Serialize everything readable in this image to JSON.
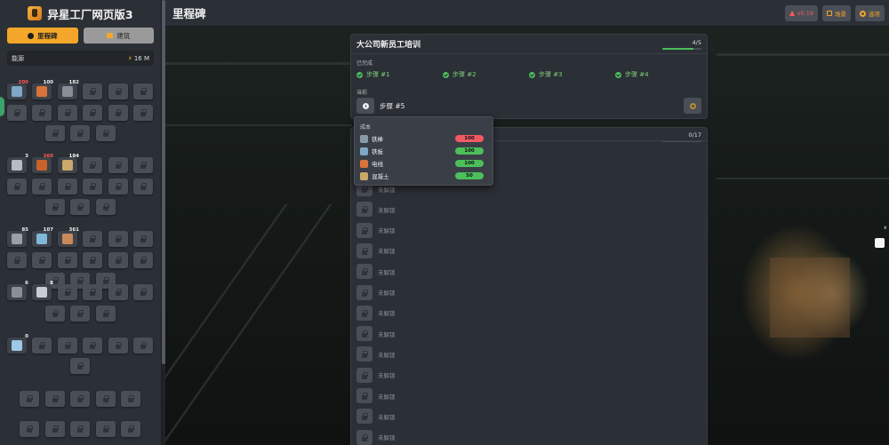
{
  "brand": {
    "title": "异星工厂网页版3"
  },
  "sidebar": {
    "tabs": [
      {
        "label": "里程碑",
        "active": true
      },
      {
        "label": "建筑",
        "active": false
      }
    ],
    "energy": {
      "label": "能源",
      "value": "16 M"
    },
    "item_counts": [
      "200",
      "100",
      "182",
      "3",
      "360",
      "184",
      "85",
      "107",
      "361",
      "6",
      "8",
      "0"
    ]
  },
  "header": {
    "title": "里程碑",
    "buttons": [
      {
        "label": "v0.19",
        "color": "#ff5a5a"
      },
      {
        "label": "场景",
        "color": "#f4a62a"
      },
      {
        "label": "选项",
        "color": "#f4a62a"
      }
    ]
  },
  "milestone": {
    "title": "大公司新员工培训",
    "progress_text": "4/5",
    "progress_fraction": 0.8,
    "completed_label": "已完成",
    "completed_steps": [
      "步骤 #1",
      "步骤 #2",
      "步骤 #3",
      "步骤 #4"
    ],
    "current_label": "当前",
    "current_step": "步骤 #5"
  },
  "list_panel": {
    "progress_text": "0/17",
    "locked_label": "未解锁",
    "locked_count": 14
  },
  "cost_popup": {
    "title": "成本",
    "items": [
      {
        "name": "铁棒",
        "amount": "100",
        "status": "insufficient",
        "icon": "iron-stick-icon",
        "color": "#8a9aa8"
      },
      {
        "name": "铁板",
        "amount": "100",
        "status": "sufficient",
        "icon": "iron-plate-icon",
        "color": "#7fa8c8"
      },
      {
        "name": "电线",
        "amount": "100",
        "status": "sufficient",
        "icon": "copper-wire-icon",
        "color": "#d8733a"
      },
      {
        "name": "混凝土",
        "amount": "50",
        "status": "sufficient",
        "icon": "concrete-icon",
        "color": "#c9a86a"
      }
    ]
  },
  "colors": {
    "accent": "#f4a62a",
    "success": "#4cbf5a",
    "danger": "#f05a64",
    "panel": "#2b2f36"
  }
}
